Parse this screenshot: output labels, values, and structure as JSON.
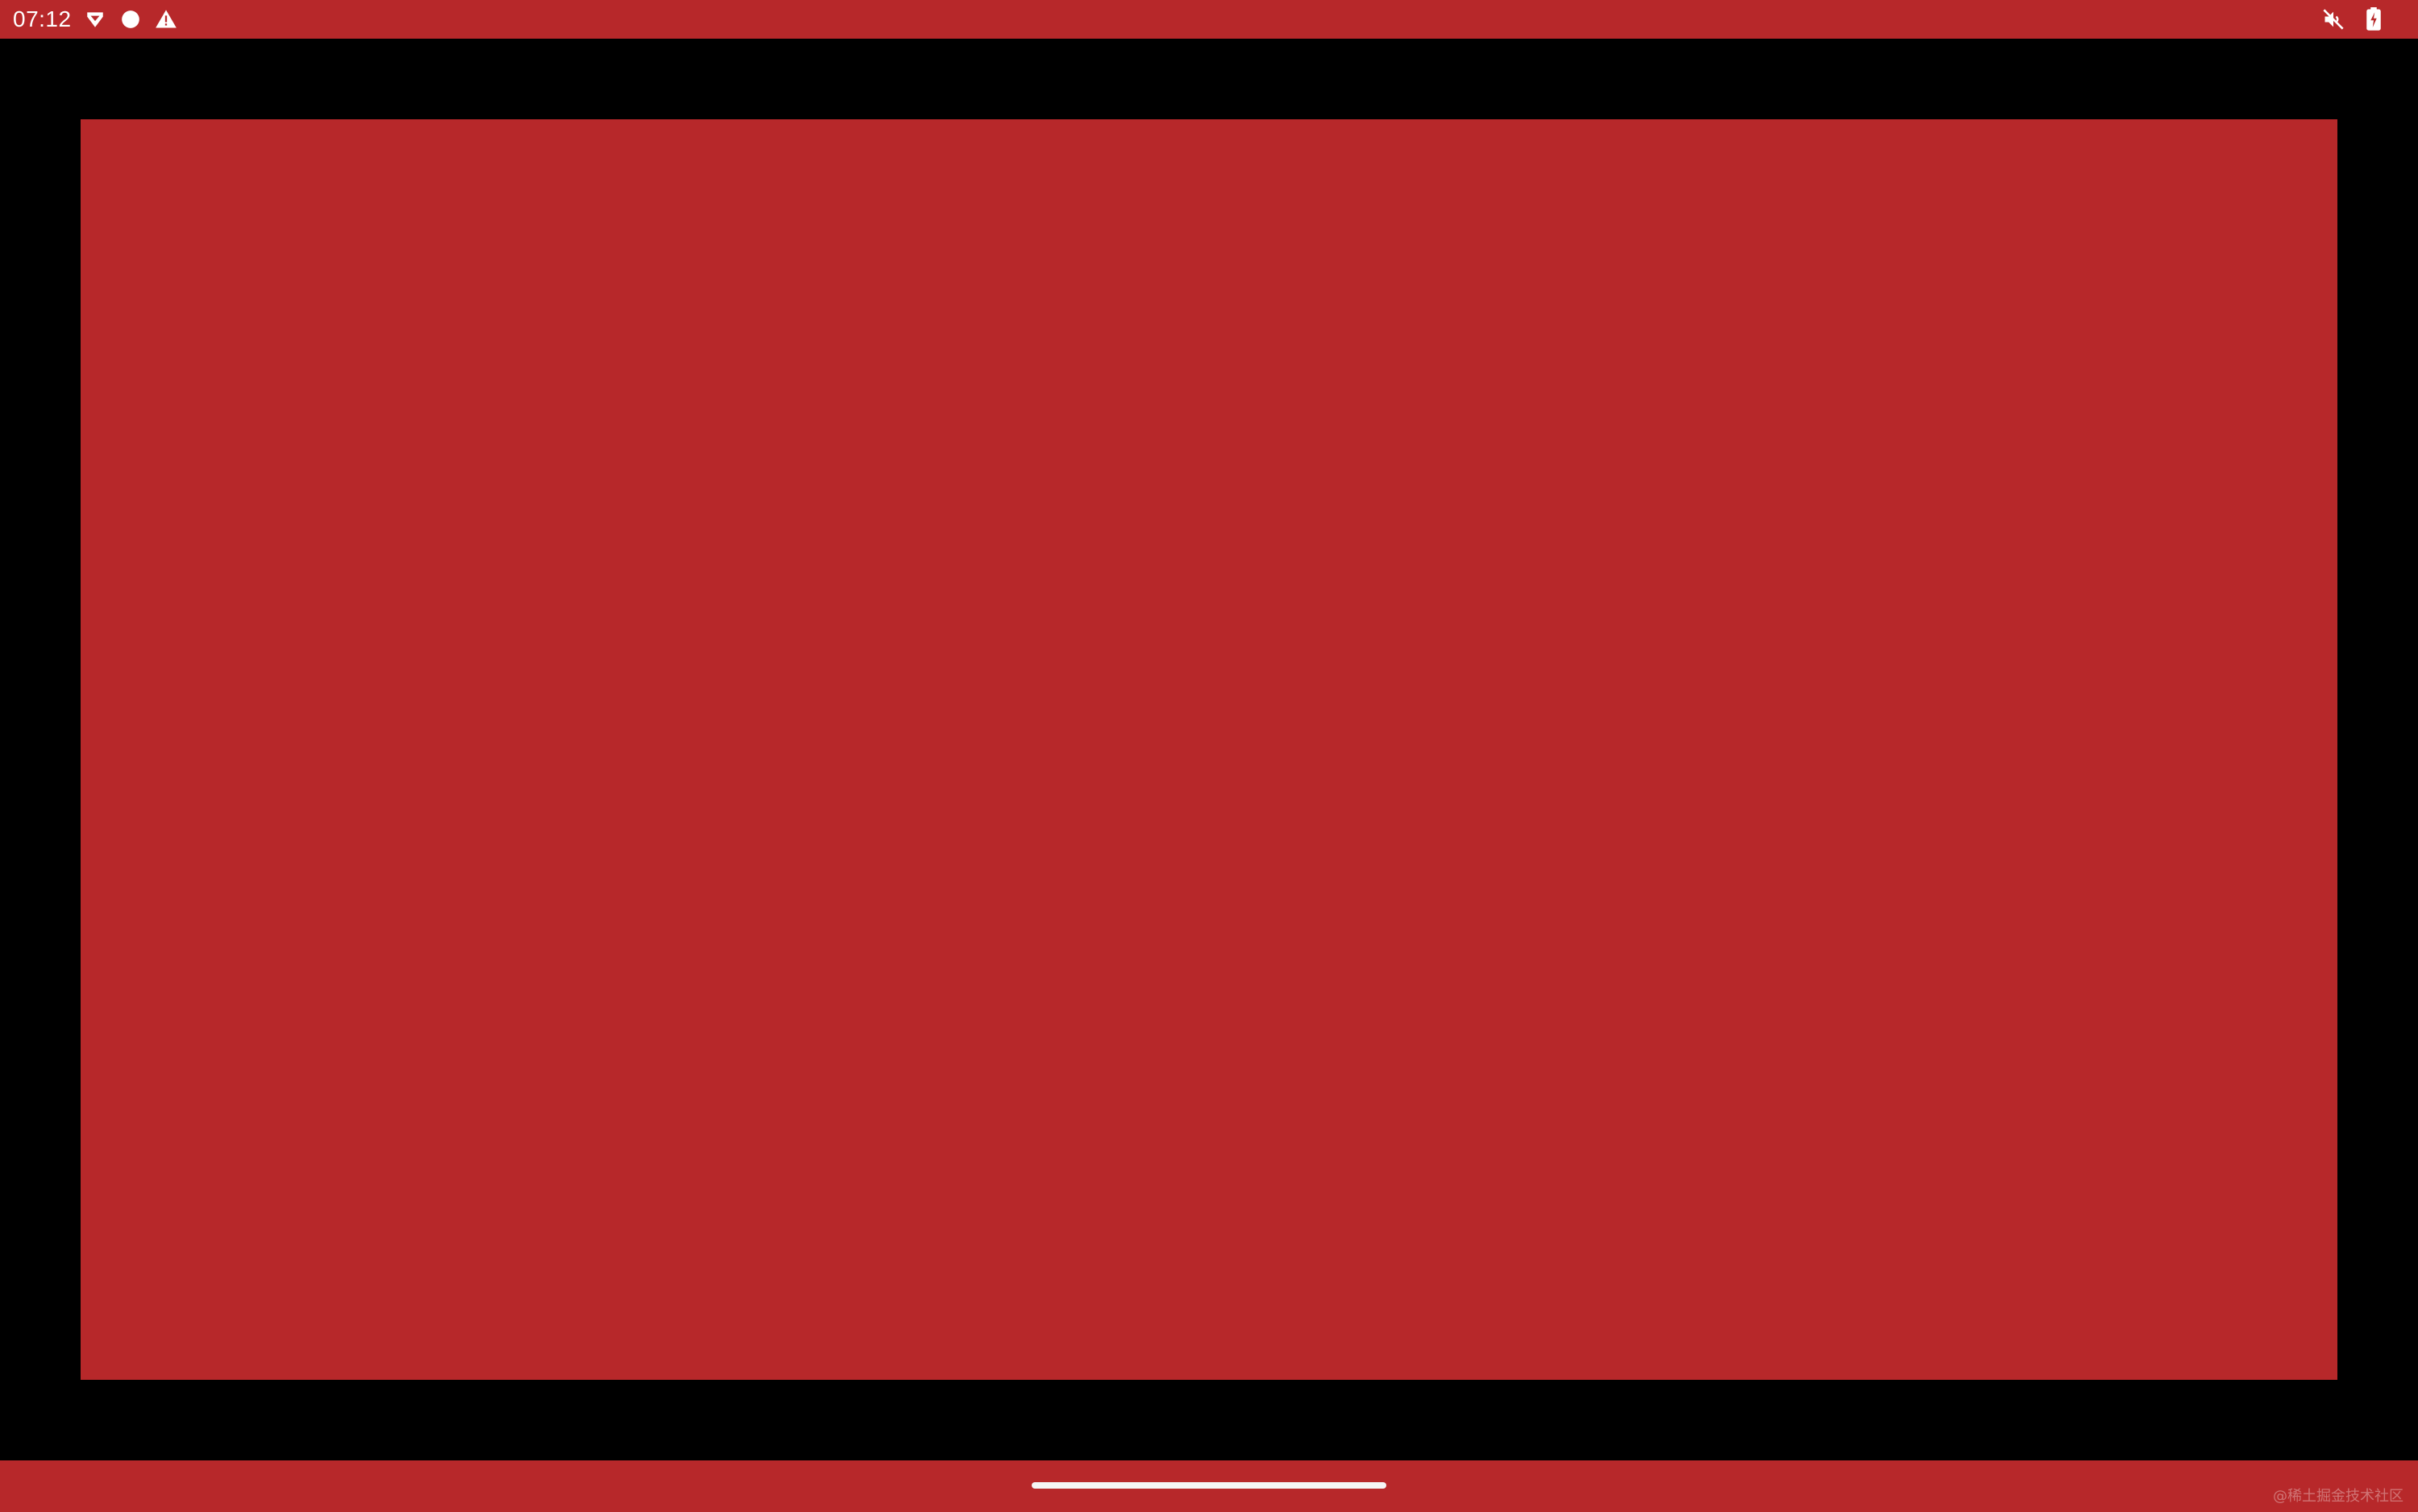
{
  "status_bar": {
    "time": "07:12",
    "background_color": "#b7282a",
    "left_icons": [
      "shield-icon",
      "record-dot-icon",
      "warning-icon"
    ],
    "right_icons": [
      "speaker-muted-icon",
      "battery-charging-icon"
    ]
  },
  "content": {
    "background_color": "#000000",
    "panel_color": "#b7282a"
  },
  "nav_bar": {
    "background_color": "#b7282a",
    "handle_color": "#f5f5f5"
  },
  "watermark": {
    "text": "@稀土掘金技术社区"
  }
}
